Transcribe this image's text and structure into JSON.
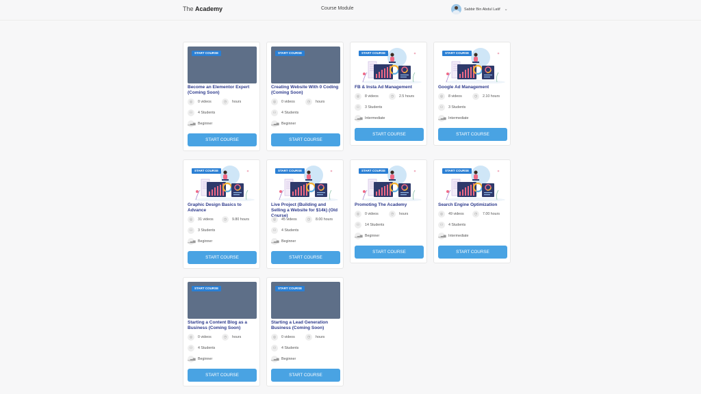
{
  "header": {
    "brand_prefix": "The",
    "brand_name": "Academy",
    "page_title": "Course Module",
    "user_name": "Sabbir Bin Abdul Latif",
    "chevron": "⌄"
  },
  "card_ui": {
    "badge_label": "START COURSE",
    "button_label": "START COURSE"
  },
  "colors": {
    "title": "#2d3a8c",
    "button": "#49a3e3",
    "badge": "#2a7fd4",
    "placeholder_thumb": "#5e6f88"
  },
  "courses": [
    {
      "title": "Become an Elementor Expert (Coming Soon)",
      "videos": "0 videos",
      "hours": "hours",
      "students": "4 Students",
      "level": "Beginner",
      "thumbnail": "placeholder"
    },
    {
      "title": "Creating Website With 0 Coding (Coming Soon)",
      "videos": "0 videos",
      "hours": "hours",
      "students": "4 Students",
      "level": "Beginner",
      "thumbnail": "placeholder"
    },
    {
      "title": "FB & Insta Ad Management",
      "videos": "8 videos",
      "hours": "2.5 hours",
      "students": "3 Students",
      "level": "Intermediate",
      "thumbnail": "illustration"
    },
    {
      "title": "Google Ad Management",
      "videos": "8 videos",
      "hours": "2.10 hours",
      "students": "3 Students",
      "level": "Intermediate",
      "thumbnail": "illustration"
    },
    {
      "title": "Graphic Design Basics to Advance",
      "videos": "31 videos",
      "hours": "9.80 hours",
      "students": "3 Students",
      "level": "Beginner",
      "thumbnail": "illustration"
    },
    {
      "title": "Live Project (Building and Selling a Website for $14k) (Old Course)",
      "videos": "45 videos",
      "hours": "8.00 hours",
      "students": "4 Students",
      "level": "Beginner",
      "thumbnail": "illustration"
    },
    {
      "title": "Promoting The Academy",
      "videos": "0 videos",
      "hours": "hours",
      "students": "14 Students",
      "level": "Beginner",
      "thumbnail": "illustration"
    },
    {
      "title": "Search Engine Optimization",
      "videos": "49 videos",
      "hours": "7.00 hours",
      "students": "4 Students",
      "level": "Intermediate",
      "thumbnail": "illustration"
    },
    {
      "title": "Starting a Content Blog as a Business (Coming Soon)",
      "videos": "0 videos",
      "hours": "hours",
      "students": "4 Students",
      "level": "Beginner",
      "thumbnail": "placeholder"
    },
    {
      "title": "Starting a Lead Generation Business (Coming Soon)",
      "videos": "0 videos",
      "hours": "hours",
      "students": "4 Students",
      "level": "Beginner",
      "thumbnail": "placeholder"
    }
  ]
}
